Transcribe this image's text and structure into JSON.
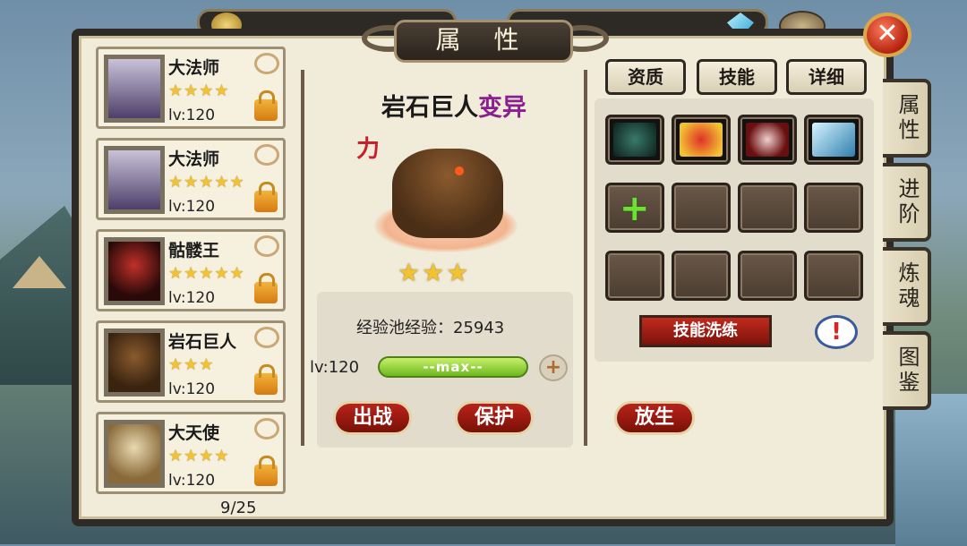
{
  "window": {
    "title": "属 性"
  },
  "side_tabs": [
    "属性",
    "进阶",
    "炼魂",
    "图鉴"
  ],
  "hero_list": {
    "items": [
      {
        "name": "大法师",
        "stars": "★★★★",
        "level": "lv:120"
      },
      {
        "name": "大法师",
        "stars": "★★★★★",
        "level": "lv:120"
      },
      {
        "name": "骷髅王",
        "stars": "★★★★★",
        "level": "lv:120"
      },
      {
        "name": "岩石巨人",
        "stars": "★★★",
        "level": "lv:120"
      },
      {
        "name": "大天使",
        "stars": "★★★★",
        "level": "lv:120"
      }
    ],
    "page_count": "9/25"
  },
  "hero": {
    "name": "岩石巨人",
    "mutation": "变异",
    "type_badge": "力",
    "stars": "★★★",
    "exp_pool_label": "经验池经验：",
    "exp_pool_value": "25943",
    "level": "lv:120",
    "bar_text": "--max--",
    "bar_fill_percent": 100
  },
  "actions": {
    "deploy": "出战",
    "protect": "保护",
    "release": "放生"
  },
  "detail_tabs": [
    "资质",
    "技能",
    "详细"
  ],
  "skills": {
    "wash_label": "技能洗练",
    "warn_icon": "!",
    "slot_colors": [
      "#1f5f4a",
      "#b3251f",
      "#7a1a1a",
      "#5f9fbf"
    ]
  },
  "icons": {
    "close": "✕",
    "plus": "+",
    "lock": "lock-icon"
  }
}
